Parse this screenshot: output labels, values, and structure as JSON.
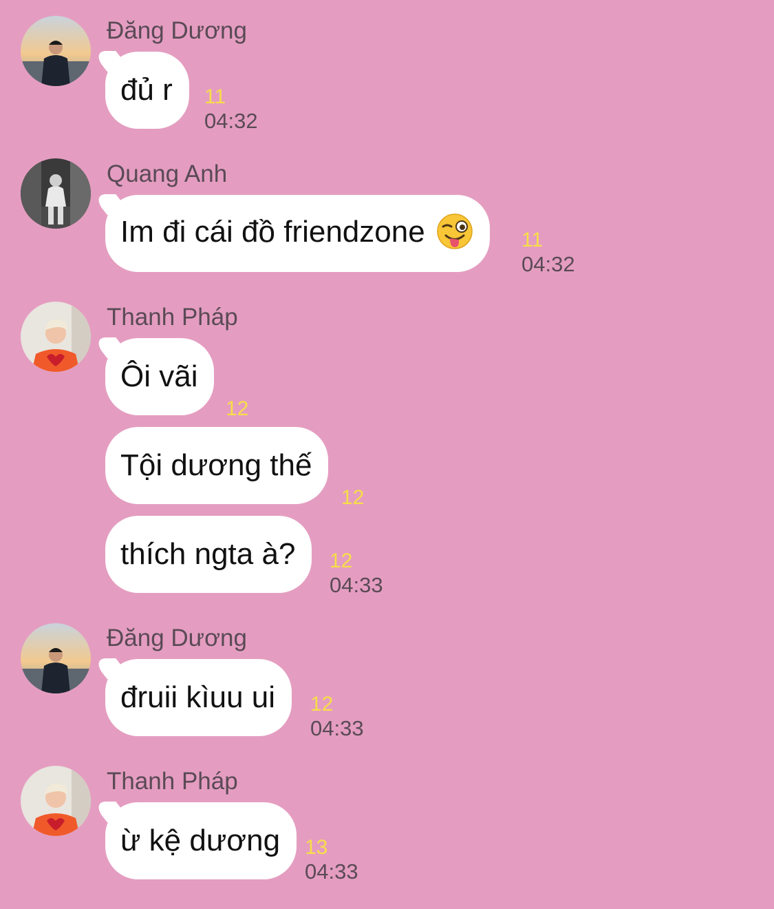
{
  "colors": {
    "background": "#e49dc0",
    "bubble": "#ffffff",
    "read_count": "#f7de48",
    "meta_text": "#5a4a56"
  },
  "messages": [
    {
      "sender": "Đăng Dương",
      "avatar_icon": "avatar-dang-duong",
      "bubbles": [
        {
          "text": "đủ r",
          "read_count": "11",
          "time": "04:32"
        }
      ]
    },
    {
      "sender": "Quang Anh",
      "avatar_icon": "avatar-quang-anh",
      "bubbles": [
        {
          "text": "Im đi cái đồ friendzone",
          "emoji": "winking-face-with-tongue",
          "read_count": "11",
          "time": "04:32"
        }
      ]
    },
    {
      "sender": "Thanh Pháp",
      "avatar_icon": "avatar-thanh-phap",
      "bubbles": [
        {
          "text": "Ôi vãi",
          "read_count": "12"
        },
        {
          "text": "Tội dương thế",
          "read_count": "12"
        },
        {
          "text": "thích ngta à?",
          "read_count": "12",
          "time": "04:33"
        }
      ]
    },
    {
      "sender": "Đăng Dương",
      "avatar_icon": "avatar-dang-duong",
      "bubbles": [
        {
          "text": "đruii kìuu ui",
          "read_count": "12",
          "time": "04:33"
        }
      ]
    },
    {
      "sender": "Thanh Pháp",
      "avatar_icon": "avatar-thanh-phap",
      "bubbles": [
        {
          "text": "ừ kệ dương",
          "read_count": "13",
          "time": "04:33"
        }
      ]
    }
  ]
}
